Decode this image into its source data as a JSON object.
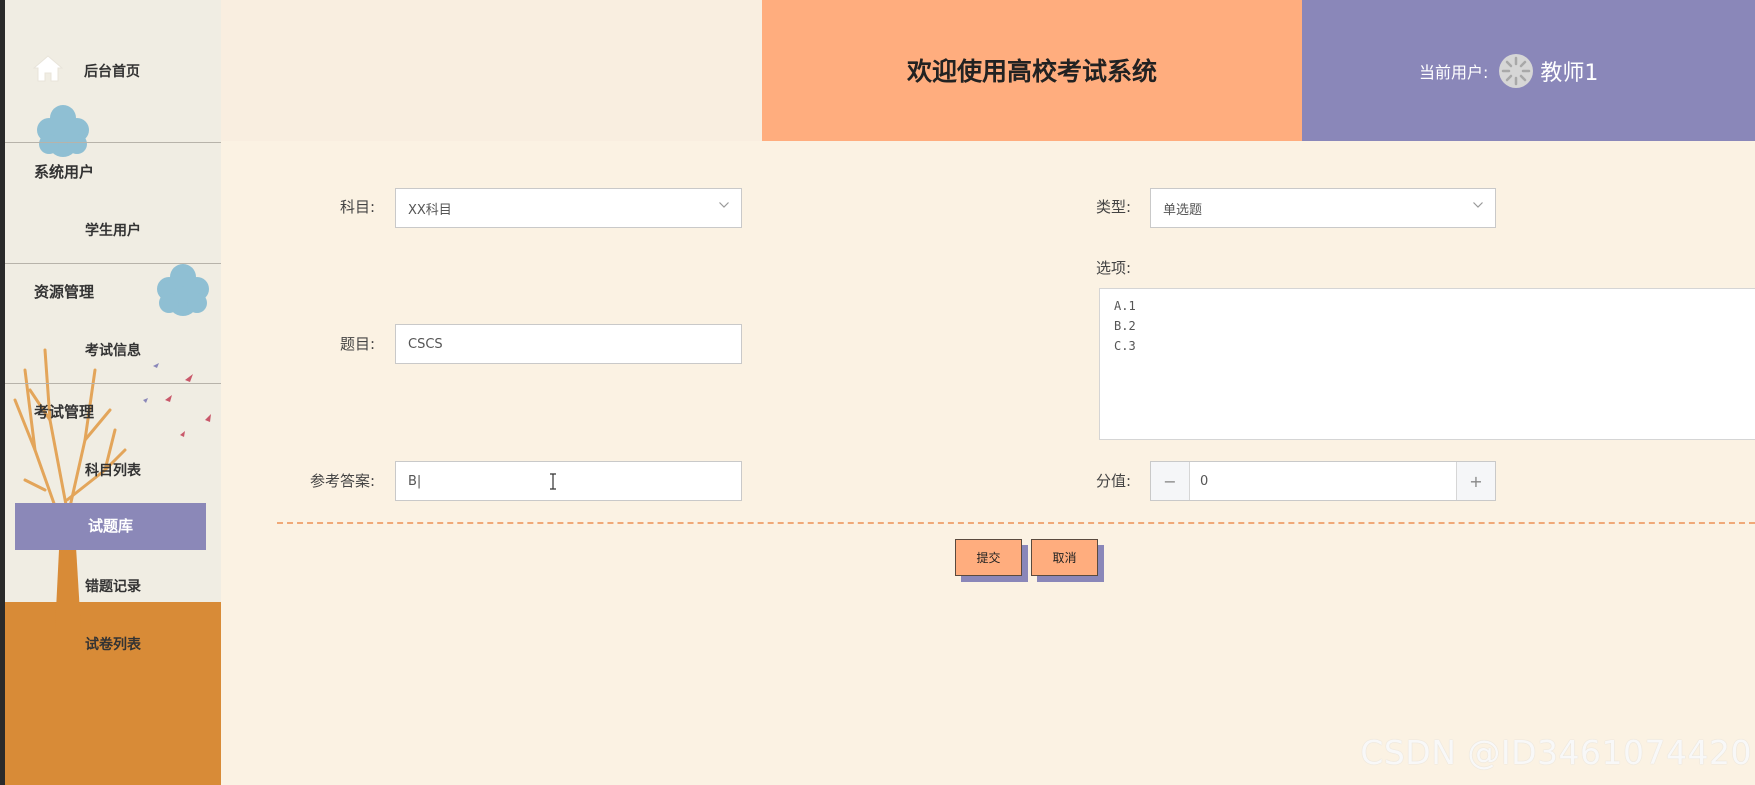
{
  "sidebar": {
    "home_label": "后台首页",
    "groups": [
      {
        "label": "系统用户",
        "items": [
          "学生用户"
        ]
      },
      {
        "label": "资源管理",
        "items": [
          "考试信息"
        ]
      },
      {
        "label": "考试管理",
        "items": [
          "科目列表",
          "试题库",
          "错题记录",
          "试卷列表"
        ]
      }
    ],
    "active_item": "试题库"
  },
  "header": {
    "title": "欢迎使用高校考试系统",
    "user_prefix": "当前用户:",
    "user_name": "教师1"
  },
  "form": {
    "subject": {
      "label": "科目:",
      "value": "XX科目"
    },
    "type": {
      "label": "类型:",
      "value": "单选题"
    },
    "options": {
      "label": "选项:",
      "lines": [
        "A.1",
        "B.2",
        "C.3"
      ]
    },
    "question": {
      "label": "题目:",
      "value": "CSCS"
    },
    "answer": {
      "label": "参考答案:",
      "value": "B|"
    },
    "score": {
      "label": "分值:",
      "value": "0",
      "minus": "−",
      "plus": "+"
    }
  },
  "buttons": {
    "submit": "提交",
    "cancel": "取消"
  },
  "watermark": "CSDN @ID3461074420",
  "colors": {
    "accent_orange": "#ffad7e",
    "accent_purple": "#8a87b9",
    "background": "#fbf2e3"
  }
}
